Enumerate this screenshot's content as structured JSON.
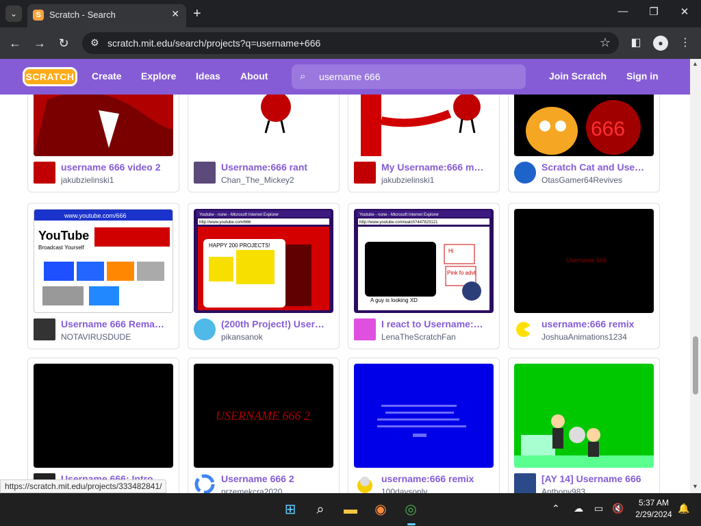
{
  "browser": {
    "tab_title": "Scratch - Search",
    "tab_favicon_letter": "S",
    "url": "scratch.mit.edu/search/projects?q=username+666",
    "status_url": "https://scratch.mit.edu/projects/333482841/"
  },
  "scratch": {
    "logo": "SCRATCH",
    "nav": [
      "Create",
      "Explore",
      "Ideas",
      "About"
    ],
    "search_value": "username 666",
    "join": "Join Scratch",
    "signin": "Sign in",
    "brand_color": "#855cd6"
  },
  "projects": [
    {
      "title": "username 666 video 2",
      "author": "jakubzielinski1"
    },
    {
      "title": "Username:666 rant",
      "author": "Chan_The_Mickey2"
    },
    {
      "title": "My Username:666 m…",
      "author": "jakubzielinski1"
    },
    {
      "title": "Scratch Cat and Use…",
      "author": "OtasGamer64Revives"
    },
    {
      "title": "Username 666 Rema…",
      "author": "NOTAVIRUSDUDE"
    },
    {
      "title": "(200th Project!) User…",
      "author": "pikansanok"
    },
    {
      "title": "I react to Username:…",
      "author": "LenaTheScratchFan"
    },
    {
      "title": "username:666 remix",
      "author": "JoshuaAnimations1234"
    },
    {
      "title": "Username 666: Intro…",
      "author": ""
    },
    {
      "title": "Username 666 2",
      "author": "przemekcra2020"
    },
    {
      "title": "username:666 remix",
      "author": "100daysonly"
    },
    {
      "title": "[AY 14] Username 666",
      "author": "Anthony983"
    }
  ],
  "thumb_text": {
    "youtube_url": "www.youtube.com/666",
    "youtube_logo": "YouTube",
    "broadcast": "Broadcast Yourself",
    "ie_title": "Youtube - none - Microsoft Internet Explorer",
    "ie_url": "http://www.youtube.com/666",
    "ie_url2": "http://www.youtube.com/watch?447823121",
    "happy": "HAPPY 200 PROJECTS!",
    "guy": "A guy is looking XD",
    "username666_red": "Username 666",
    "username666_2": "USERNAME 666 2",
    "hi": "Hi",
    "pink": "Pink fo advt"
  },
  "taskbar": {
    "time": "5:37 AM",
    "date": "2/29/2024"
  }
}
